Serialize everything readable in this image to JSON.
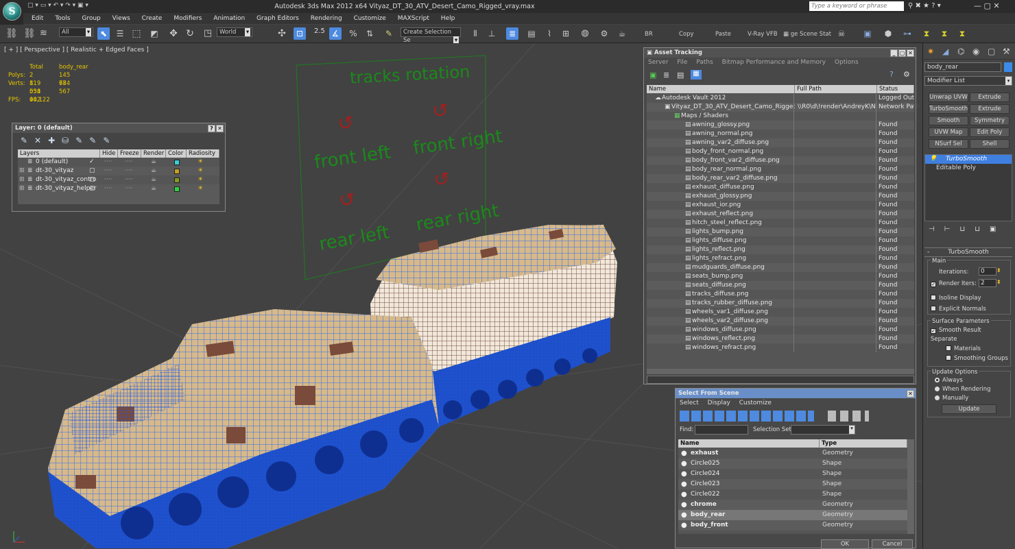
{
  "app": {
    "title": "Autodesk 3ds Max  2012 x64     Vityaz_DT_30_ATV_Desert_Camo_Rigged_vray.max",
    "search_placeholder": "Type a keyword or phrase",
    "logo_text": "S"
  },
  "menu": [
    "Edit",
    "Tools",
    "Group",
    "Views",
    "Create",
    "Modifiers",
    "Animation",
    "Graph Editors",
    "Rendering",
    "Customize",
    "MAXScript",
    "Help"
  ],
  "toolbar": {
    "filter": "All",
    "refcoord": "World",
    "snap_value": "2.5",
    "selection_set": "Create Selection Se",
    "br": "BR",
    "copy": "Copy",
    "paste": "Paste",
    "vray_vfb": "V-Ray VFB",
    "scene_state": "ge Scene Stat"
  },
  "viewport": {
    "label": "[ + ] [ Perspective ] [ Realistic + Edged Faces ]",
    "stats": {
      "col_total": "Total",
      "col_obj": "body_rear",
      "polys_label": "Polys:",
      "polys_total": "2 819 054",
      "polys_obj": "145 684",
      "verts_label": "Verts:",
      "verts_total": "1 538 942",
      "verts_obj": "77 567",
      "fps_label": "FPS:",
      "fps_value": "40,122"
    },
    "panel_text": {
      "title": "tracks rotation",
      "front_left": "front left",
      "front_right": "front right",
      "rear_left": "rear left",
      "rear_right": "rear right"
    },
    "colors": {
      "background": "#424242",
      "wire": "#2f6bf0",
      "panel": "#1d6a1d",
      "camo_base": "#d7b98a",
      "camo_dark": "#7a4a3a"
    }
  },
  "layer_window": {
    "title": "Layer: 0 (default)",
    "columns": [
      "Layers",
      "Hide",
      "Freeze",
      "Render",
      "Color",
      "Radiosity"
    ],
    "rows": [
      {
        "name": "0 (default)",
        "color": "#3ad0d8",
        "active": true
      },
      {
        "name": "dt-30_vityaz",
        "color": "#c8a020",
        "active": false
      },
      {
        "name": "dt-30_vityaz_contro",
        "color": "#8a9a20",
        "active": false
      },
      {
        "name": "dt-30_vityaz_helper",
        "color": "#30d040",
        "active": false
      }
    ]
  },
  "asset_tracking": {
    "title": "Asset Tracking",
    "menu": [
      "Server",
      "File",
      "Paths",
      "Bitmap Performance and Memory",
      "Options"
    ],
    "columns": [
      "Name",
      "Full Path",
      "Status"
    ],
    "vault": {
      "name": "Autodesk Vault 2012",
      "path": "",
      "status": "Logged Out ("
    },
    "file": {
      "name": "Vityaz_DT_30_ATV_Desert_Camo_Rigged_...",
      "path": "\\\\R0\\d\\!render\\AndreyK\\N...",
      "status": "Network Path"
    },
    "group": "Maps / Shaders",
    "maps": [
      "awning_glossy.png",
      "awning_normal.png",
      "awning_var2_diffuse.png",
      "body_front_normal.png",
      "body_front_var2_diffuse.png",
      "body_rear_normal.png",
      "body_rear_var2_diffuse.png",
      "exhaust_diffuse.png",
      "exhaust_glossy.png",
      "exhaust_ior.png",
      "exhaust_reflect.png",
      "hitch_steel_reflect.png",
      "lights_bump.png",
      "lights_diffuse.png",
      "lights_reflect.png",
      "lights_refract.png",
      "mudguards_diffuse.png",
      "seats_bump.png",
      "seats_diffuse.png",
      "tracks_diffuse.png",
      "tracks_rubber_diffuse.png",
      "wheels_var1_diffuse.png",
      "wheels_var2_diffuse.png",
      "windows_diffuse.png",
      "windows_reflect.png",
      "windows_refract.png"
    ],
    "found": "Found"
  },
  "select_scene": {
    "title": "Select From Scene",
    "menu": [
      "Select",
      "Display",
      "Customize"
    ],
    "find_label": "Find:",
    "selset_label": "Selection Set:",
    "columns": [
      "Name",
      "Type"
    ],
    "rows": [
      {
        "name": "exhaust",
        "type": "Geometry",
        "bold": true,
        "selected": false
      },
      {
        "name": "Circle025",
        "type": "Shape",
        "bold": false,
        "selected": false
      },
      {
        "name": "Circle024",
        "type": "Shape",
        "bold": false,
        "selected": false
      },
      {
        "name": "Circle023",
        "type": "Shape",
        "bold": false,
        "selected": false
      },
      {
        "name": "Circle022",
        "type": "Shape",
        "bold": false,
        "selected": false
      },
      {
        "name": "chrome",
        "type": "Geometry",
        "bold": true,
        "selected": false
      },
      {
        "name": "body_rear",
        "type": "Geometry",
        "bold": true,
        "selected": true
      },
      {
        "name": "body_front",
        "type": "Geometry",
        "bold": true,
        "selected": false
      }
    ],
    "ok": "OK",
    "cancel": "Cancel"
  },
  "command_panel": {
    "object_name": "body_rear",
    "modifier_list": "Modifier List",
    "buttons": [
      [
        "Unwrap UVW",
        "Extrude"
      ],
      [
        "TurboSmooth",
        "Extrude"
      ],
      [
        "Smooth",
        "Symmetry"
      ],
      [
        "UVW Map",
        "Edit Poly"
      ],
      [
        "NSurf Sel",
        "Shell"
      ]
    ],
    "stack": [
      "TurboSmooth",
      "Editable Poly"
    ],
    "rollout_title": "TurboSmooth",
    "main_label": "Main",
    "iterations_label": "Iterations:",
    "iterations_value": "0",
    "render_iters_label": "Render Iters:",
    "render_iters_value": "2",
    "isoline": "Isoline Display",
    "explicit_normals": "Explicit Normals",
    "surface_params": "Surface Parameters",
    "smooth_result": "Smooth Result",
    "separate": "Separate",
    "materials": "Materials",
    "smoothing_groups": "Smoothing Groups",
    "update_options": "Update Options",
    "always": "Always",
    "when_rendering": "When Rendering",
    "manually": "Manually",
    "update": "Update"
  }
}
